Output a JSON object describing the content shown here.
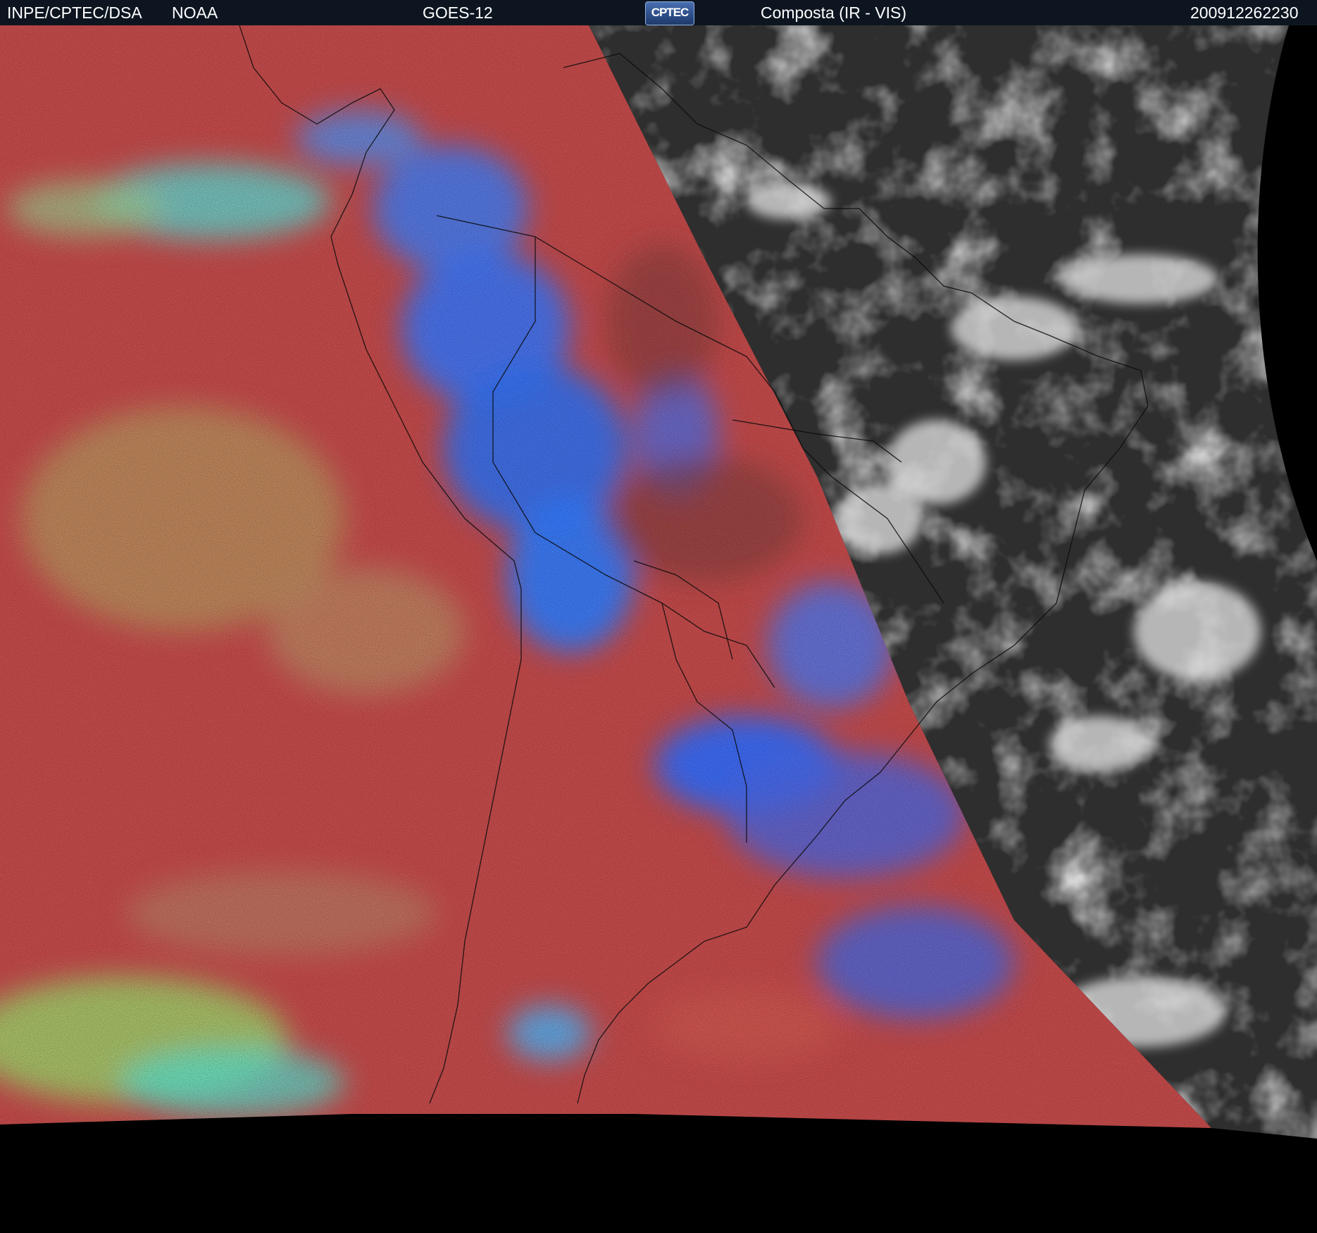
{
  "header": {
    "source_label": "INPE/CPTEC/DSA",
    "agency_label": "NOAA",
    "satellite_label": "GOES-12",
    "logo_text": "CPTEC",
    "product_label": "Composta (IR - VIS)",
    "timestamp": "200912262230"
  },
  "colors": {
    "header_background": "#0d1620",
    "ir_ocean": "#c24a4a",
    "ir_cloud_blue": "#2f7bff",
    "ir_cloud_cyan": "#4fe0e0",
    "ir_cloud_green": "#9fd080",
    "vis_background": "#2e2e2e",
    "vis_cloud": "#d8d8d8",
    "space": "#000000"
  }
}
